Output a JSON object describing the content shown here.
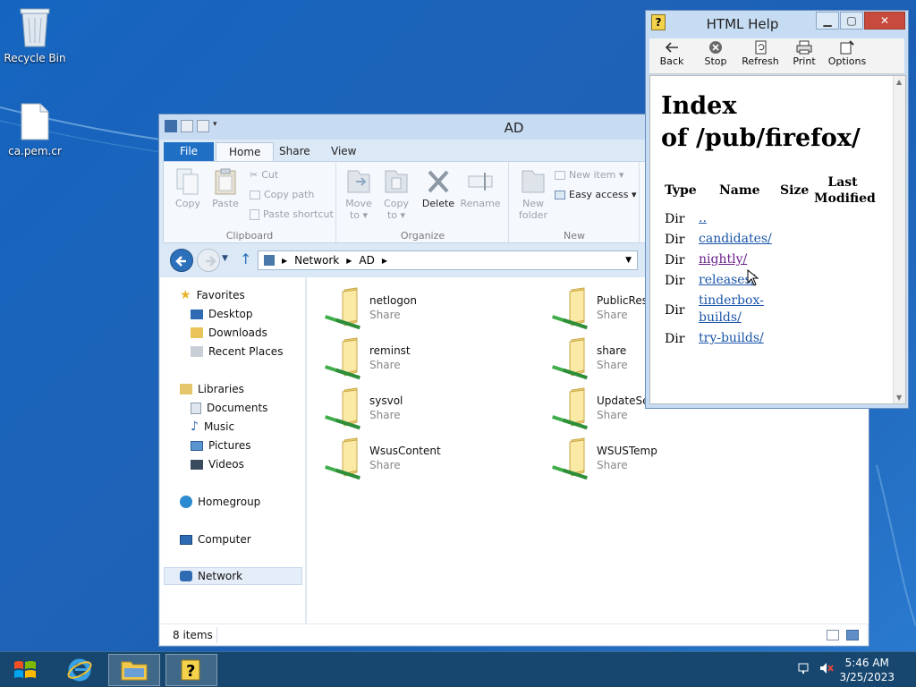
{
  "desktop": {
    "icons": [
      {
        "label": "Recycle Bin"
      },
      {
        "label": "ca.pem.cr"
      }
    ]
  },
  "explorer": {
    "title": "AD",
    "tabs": [
      {
        "label": "File"
      },
      {
        "label": "Home"
      },
      {
        "label": "Share"
      },
      {
        "label": "View"
      }
    ],
    "ribbon": {
      "clipboard": {
        "label": "Clipboard",
        "copy": "Copy",
        "paste": "Paste",
        "cut": "Cut",
        "copy_path": "Copy path",
        "paste_shortcut": "Paste shortcut"
      },
      "organize": {
        "label": "Organize",
        "move_to": "Move to ▾",
        "copy_to": "Copy to ▾",
        "delete": "Delete",
        "rename": "Rename"
      },
      "new": {
        "label": "New",
        "new_folder": "New folder",
        "new_item": "New item ▾",
        "easy_access": "Easy access ▾"
      }
    },
    "address": {
      "parts": [
        "Network",
        "AD"
      ]
    },
    "navpane": {
      "favorites": "Favorites",
      "desktop": "Desktop",
      "downloads": "Downloads",
      "recent_places": "Recent Places",
      "libraries": "Libraries",
      "documents": "Documents",
      "music": "Music",
      "pictures": "Pictures",
      "videos": "Videos",
      "homegroup": "Homegroup",
      "computer": "Computer",
      "network": "Network"
    },
    "items": [
      {
        "name": "netlogon",
        "type": "Share"
      },
      {
        "name": "PublicRes",
        "type": "Share"
      },
      {
        "name": "reminst",
        "type": "Share"
      },
      {
        "name": "share",
        "type": "Share"
      },
      {
        "name": "sysvol",
        "type": "Share"
      },
      {
        "name": "UpdateSer",
        "type": "Share"
      },
      {
        "name": "WsusContent",
        "type": "Share"
      },
      {
        "name": "WSUSTemp",
        "type": "Share"
      }
    ],
    "status": {
      "count": "8 items"
    }
  },
  "help": {
    "title": "HTML Help",
    "toolbar": {
      "back": "Back",
      "stop": "Stop",
      "refresh": "Refresh",
      "print": "Print",
      "options": "Options"
    },
    "page": {
      "heading_line1": "Index",
      "heading_line2": "of /pub/firefox/",
      "columns": {
        "type": "Type",
        "name": "Name",
        "size": "Size",
        "last_modified_1": "Last",
        "last_modified_2": "Modified"
      },
      "rows": [
        {
          "type": "Dir",
          "name": ".."
        },
        {
          "type": "Dir",
          "name": "candidates/"
        },
        {
          "type": "Dir",
          "name": "nightly/"
        },
        {
          "type": "Dir",
          "name": "releases/"
        },
        {
          "type": "Dir",
          "name_line1": "tinderbox-",
          "name_line2": "builds/"
        },
        {
          "type": "Dir",
          "name": "try-builds/"
        }
      ]
    }
  },
  "taskbar": {
    "time": "5:46 AM",
    "date": "3/25/2023"
  }
}
